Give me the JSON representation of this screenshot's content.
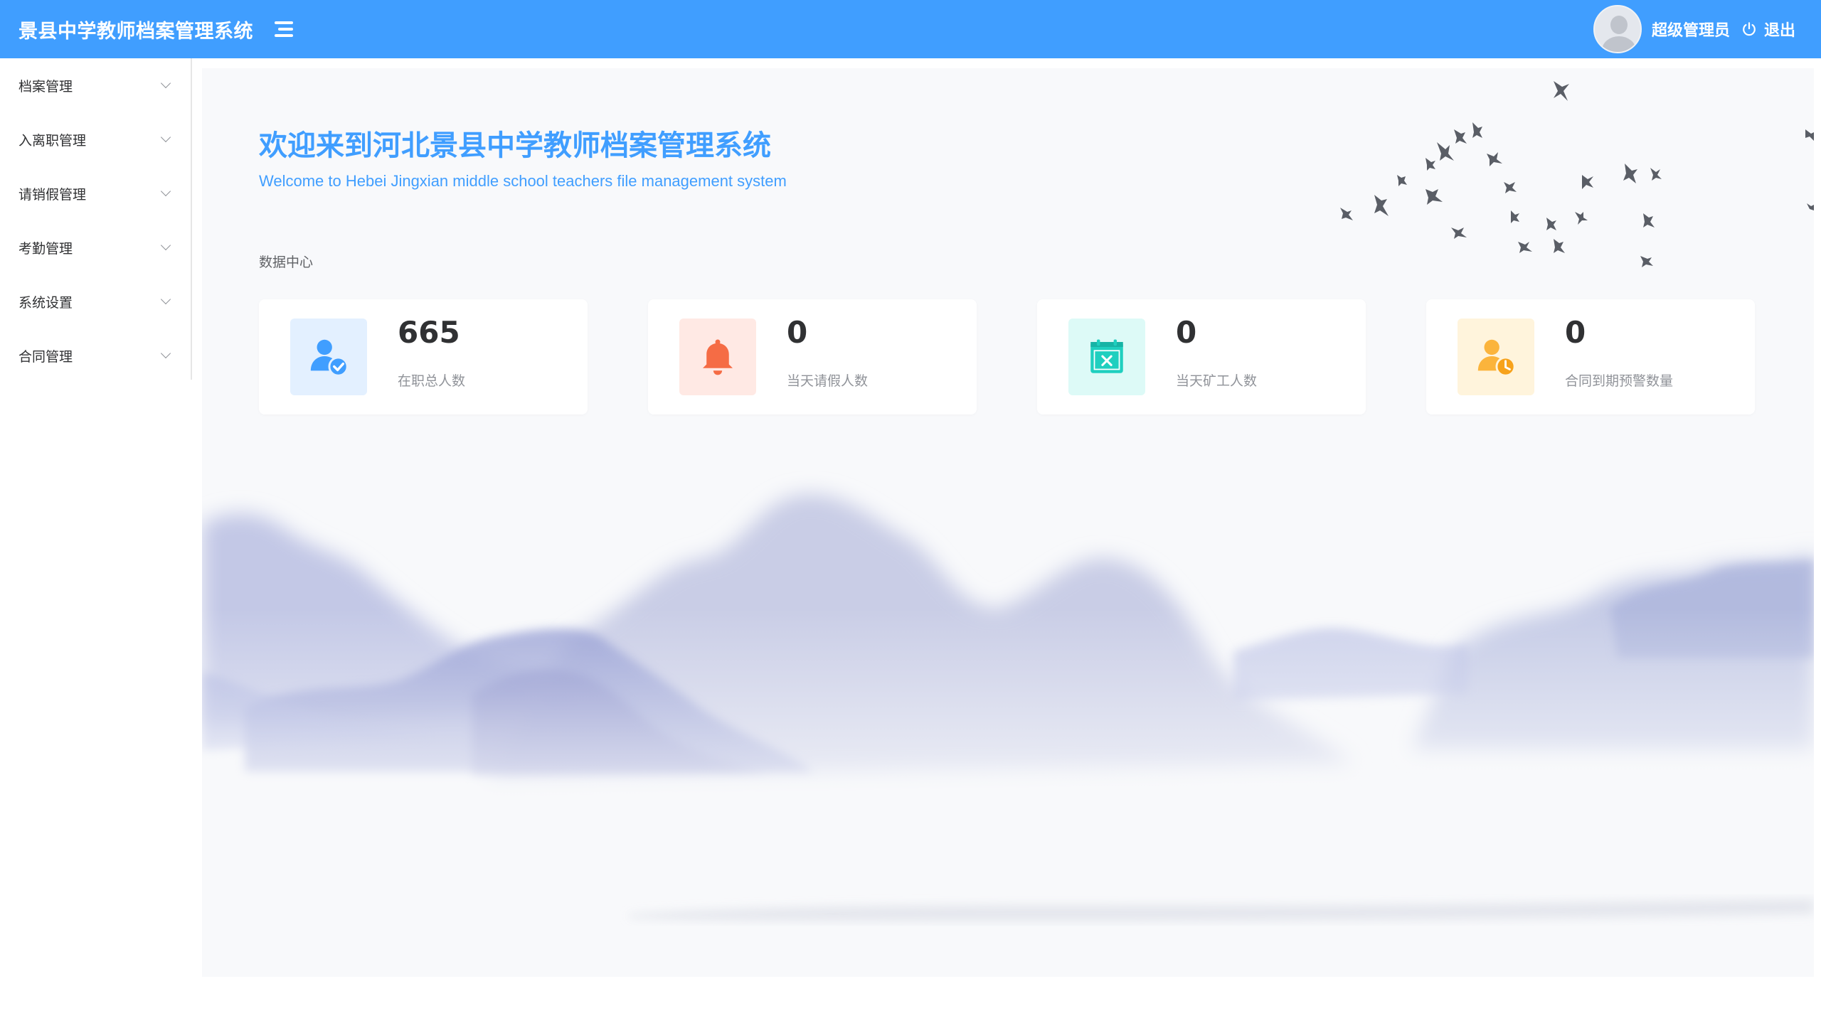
{
  "header": {
    "title": "景县中学教师档案管理系统",
    "username": "超级管理员",
    "logout_label": "退出",
    "brand_color": "#409eff"
  },
  "sidebar": {
    "items": [
      {
        "label": "档案管理"
      },
      {
        "label": "入离职管理"
      },
      {
        "label": "请销假管理"
      },
      {
        "label": "考勤管理"
      },
      {
        "label": "系统设置"
      },
      {
        "label": "合同管理"
      }
    ]
  },
  "main": {
    "welcome_title": "欢迎来到河北景县中学教师档案管理系统",
    "welcome_subtitle": "Welcome to Hebei Jingxian middle school teachers file management system",
    "section_title": "数据中心",
    "cards": [
      {
        "value": "665",
        "caption": "在职总人数",
        "icon": "user-check-icon",
        "color": "#409eff",
        "bg": "#e3f0ff"
      },
      {
        "value": "0",
        "caption": "当天请假人数",
        "icon": "bell-icon",
        "color": "#f56c45",
        "bg": "#ffe9e4"
      },
      {
        "value": "0",
        "caption": "当天矿工人数",
        "icon": "calendar-x-icon",
        "color": "#1fcfbf",
        "bg": "#ddfaf7"
      },
      {
        "value": "0",
        "caption": "合同到期预警数量",
        "icon": "user-clock-icon",
        "color": "#fbb43c",
        "bg": "#fff4dc"
      }
    ]
  }
}
